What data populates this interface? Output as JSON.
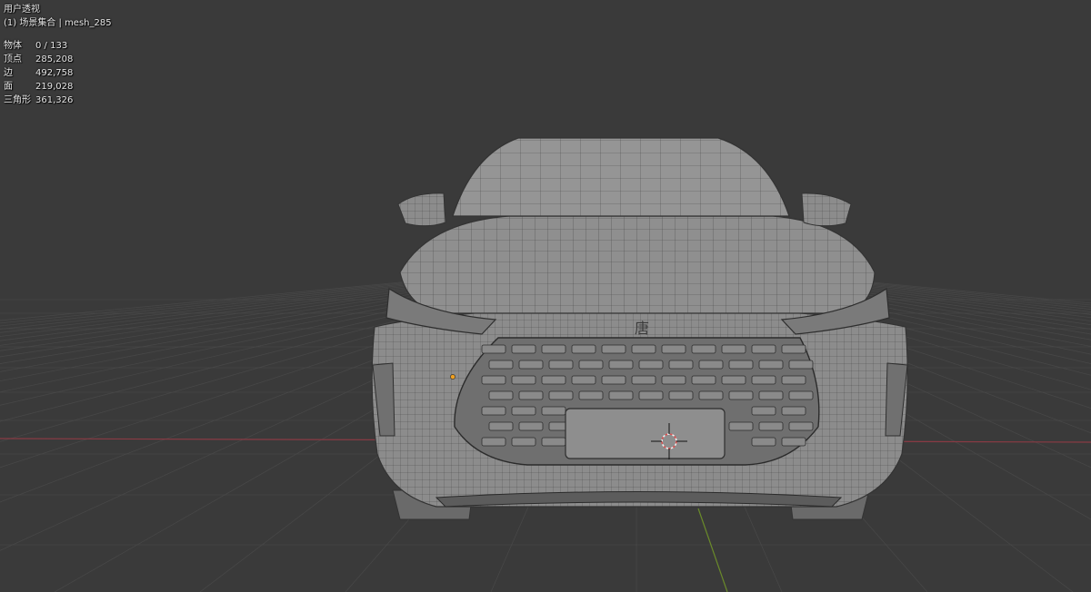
{
  "viewport": {
    "view_name": "用户透视",
    "collection": "(1) 场景集合 | mesh_285",
    "stats": [
      {
        "label": "物体",
        "value": "0 / 133"
      },
      {
        "label": "顶点",
        "value": "285,208"
      },
      {
        "label": "边",
        "value": "492,758"
      },
      {
        "label": "面",
        "value": "219,028"
      },
      {
        "label": "三角形",
        "value": "361,326"
      }
    ],
    "badge_glyph": "唐"
  },
  "colors": {
    "background": "#3a3a3a",
    "grid_line": "#474747",
    "x_axis": "#8a3a44",
    "y_axis": "#6a8a2a",
    "mesh_fill": "#8f8f8f",
    "mesh_wire": "#3c3c3c",
    "origin_dot": "#f0a020",
    "cursor_red": "#e05050"
  }
}
